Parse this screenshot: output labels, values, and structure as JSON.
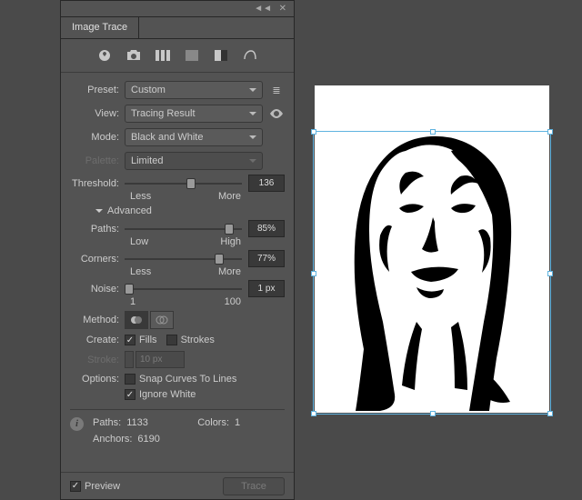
{
  "panel": {
    "title": "Image Trace",
    "preset_label": "Preset:",
    "preset_value": "Custom",
    "view_label": "View:",
    "view_value": "Tracing Result",
    "mode_label": "Mode:",
    "mode_value": "Black and White",
    "palette_label": "Palette:",
    "palette_value": "Limited",
    "threshold_label": "Threshold:",
    "threshold_value": "136",
    "threshold_min": "Less",
    "threshold_max": "More",
    "advanced_label": "Advanced",
    "paths_label": "Paths:",
    "paths_value": "85%",
    "paths_min": "Low",
    "paths_max": "High",
    "corners_label": "Corners:",
    "corners_value": "77%",
    "corners_min": "Less",
    "corners_max": "More",
    "noise_label": "Noise:",
    "noise_value": "1 px",
    "noise_min": "1",
    "noise_max": "100",
    "method_label": "Method:",
    "create_label": "Create:",
    "fills_label": "Fills",
    "strokes_label": "Strokes",
    "stroke_label": "Stroke:",
    "stroke_value": "10 px",
    "options_label": "Options:",
    "snap_label": "Snap Curves To Lines",
    "ignore_label": "Ignore White",
    "info_paths_label": "Paths:",
    "info_paths_value": "1133",
    "info_colors_label": "Colors:",
    "info_colors_value": "1",
    "info_anchors_label": "Anchors:",
    "info_anchors_value": "6190",
    "preview_label": "Preview",
    "trace_label": "Trace"
  }
}
